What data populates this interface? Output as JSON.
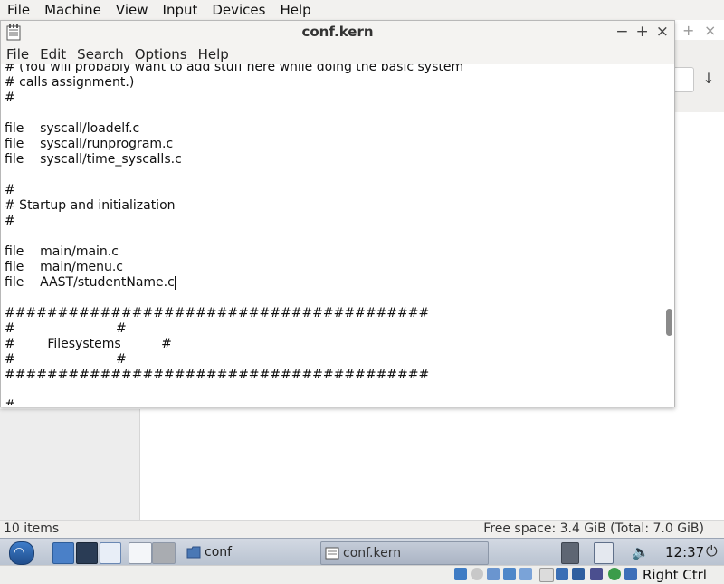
{
  "vbox_menu": [
    "File",
    "Machine",
    "View",
    "Input",
    "Devices",
    "Help"
  ],
  "editor": {
    "title": "conf.kern",
    "menu": [
      "File",
      "Edit",
      "Search",
      "Options",
      "Help"
    ],
    "lines": [
      "# (You will probably want to add stuff here while doing the basic system",
      "# calls assignment.)",
      "#",
      "",
      "file    syscall/loadelf.c",
      "file    syscall/runprogram.c",
      "file    syscall/time_syscalls.c",
      "",
      "#",
      "# Startup and initialization",
      "#",
      "",
      "file    main/main.c",
      "file    main/menu.c",
      "file    AAST/studentName.c",
      "",
      "########################################",
      "#                         #",
      "#        Filesystems          #",
      "#                         #",
      "########################################",
      "",
      "#"
    ],
    "scroll_position": 0.79
  },
  "file_manager": {
    "items_count": "10 items",
    "free_space": "Free space: 3.4 GiB (Total: 7.0 GiB)"
  },
  "taskbar": {
    "tasks": [
      {
        "label": "conf",
        "icon": "folder-icon"
      },
      {
        "label": "conf.kern",
        "icon": "text-editor-icon"
      }
    ],
    "clock": "12:37"
  },
  "vbox_status": {
    "host_key": "Right Ctrl"
  },
  "colors": {
    "taskbar": "#c6cedb",
    "editor_bg": "#ffffff",
    "chrome": "#f4f3f1"
  }
}
